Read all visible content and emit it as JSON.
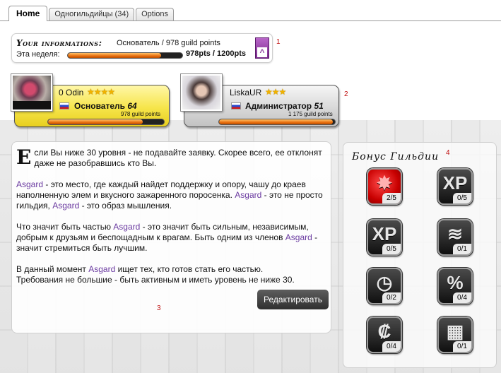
{
  "tabs": [
    {
      "label": "Home",
      "active": true
    },
    {
      "label": "Одногильдийцы (34)",
      "active": false
    },
    {
      "label": "Options",
      "active": false
    }
  ],
  "info": {
    "title": "Your informations:",
    "rank_points": "Основатель / 978 guild points",
    "week_label": "Эта неделя:",
    "week_points": "978pts / 1200pts",
    "week_progress": 0.815,
    "marker": "1"
  },
  "members": [
    {
      "name": "0 Odin",
      "stars": "★★★★",
      "role": "Основатель",
      "level": "64",
      "points": "978 guild points",
      "progress": 0.82
    },
    {
      "name": "LiskaUR",
      "stars": "★★★",
      "role": "Администратор",
      "level": "51",
      "points": "1 175 guild points",
      "progress": 0.98
    }
  ],
  "members_marker": "2",
  "main": {
    "dropcap": "Е",
    "p1": "сли Вы ниже 30 уровня - не подавайте заявку. Скорее всего, ее отклонят даже не разобравшись кто Вы.",
    "guild_name": "Asgard",
    "p2a": " - это место, где каждый найдет поддержку и опору, чашу до краев наполненную элем и вкусного зажаренного поросенка. ",
    "p2b": " - это не просто гильдия, ",
    "p2c": " - это образ мышления.",
    "p3a": "Что значит быть частью ",
    "p3b": " - это значит быть сильным, независимым, добрым к друзьям и беспощадным к врагам. Быть одним из членов ",
    "p3c": " - значит стремиться быть лучшим.",
    "p4a": "В данный момент ",
    "p4b": " ищет тех, кто готов стать его частью.",
    "p4c": "Требования не большие - быть активным и иметь уровень не ниже 30.",
    "edit_label": "Редактировать",
    "marker": "3"
  },
  "bonus": {
    "title": "Бонус Гильдии",
    "marker": "4",
    "items": [
      {
        "icon": "red-splash-icon",
        "glyph": "✸",
        "count": "2/5"
      },
      {
        "icon": "xp-icon",
        "glyph": "XP",
        "count": "0/5"
      },
      {
        "icon": "xp-plus-icon",
        "glyph": "XP",
        "count": "0/5"
      },
      {
        "icon": "scroll-icon",
        "glyph": "≋",
        "count": "0/1"
      },
      {
        "icon": "stopwatch-icon",
        "glyph": "◷",
        "count": "0/2"
      },
      {
        "icon": "percent-icon",
        "glyph": "%",
        "count": "0/4"
      },
      {
        "icon": "currency-icon",
        "glyph": "₡",
        "count": "0/4"
      },
      {
        "icon": "bandage-icon",
        "glyph": "▦",
        "count": "0/1"
      }
    ]
  },
  "colors": {
    "accent_link": "#6a3aa0",
    "card_founder": "#f6e54a",
    "card_admin": "#d6d6d6",
    "progress_fill": "#e96f0f"
  }
}
